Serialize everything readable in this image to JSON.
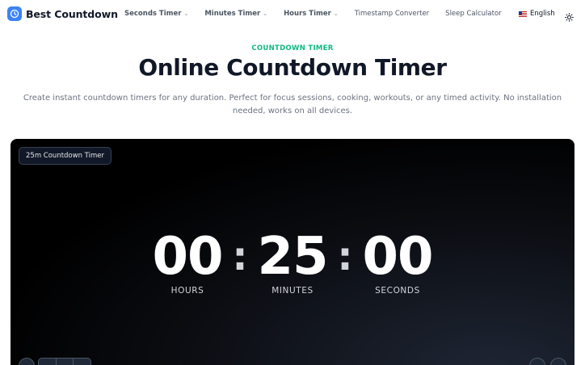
{
  "header": {
    "brand": "Best Countdown",
    "nav": [
      {
        "label": "Seconds Timer",
        "dropdown": true
      },
      {
        "label": "Minutes Timer",
        "dropdown": true
      },
      {
        "label": "Hours Timer",
        "dropdown": true
      },
      {
        "label": "Timestamp Converter",
        "dropdown": false
      },
      {
        "label": "Sleep Calculator",
        "dropdown": false
      }
    ],
    "language": "English"
  },
  "hero": {
    "eyebrow": "COUNTDOWN TIMER",
    "title": "Online Countdown Timer",
    "description": "Create instant countdown timers for any duration. Perfect for focus sessions, cooking, workouts, or any timed activity. No installation needed, works on all devices."
  },
  "timer": {
    "badge": "25m Countdown Timer",
    "hours": "00",
    "minutes": "25",
    "seconds": "00",
    "hours_label": "HOURS",
    "minutes_label": "MINUTES",
    "seconds_label": "SECONDS",
    "separator": ":"
  },
  "colors": {
    "accent": "#10b981",
    "brand": "#3b82f6",
    "card_bg": "#000000"
  },
  "icons": [
    "clock-icon",
    "chevron-down-icon",
    "flag-us-icon",
    "sun-icon"
  ]
}
